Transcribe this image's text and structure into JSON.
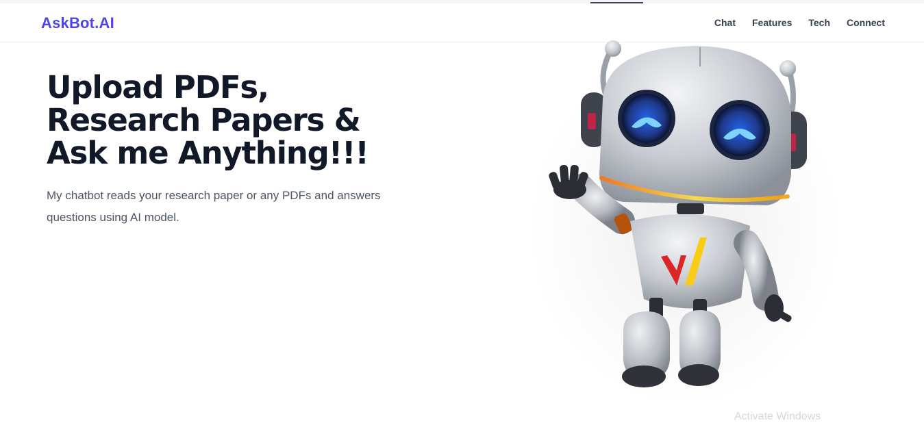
{
  "brand": {
    "name": "AskBot.AI"
  },
  "nav": {
    "items": [
      "Chat",
      "Features",
      "Tech",
      "Connect"
    ]
  },
  "hero": {
    "title_lines": [
      "Upload PDFs,",
      "Research Papers &",
      "Ask me Anything!!!"
    ],
    "subtitle": "My chatbot reads your research paper or any PDFs and answers questions using AI model."
  },
  "watermark": {
    "text": "Activate Windows"
  },
  "colors": {
    "brand": "#4f46e5",
    "heading": "#111827",
    "body_text": "#4b5563",
    "robot_eyes": "#1d4ed8",
    "robot_smile": "#f59e0b"
  }
}
